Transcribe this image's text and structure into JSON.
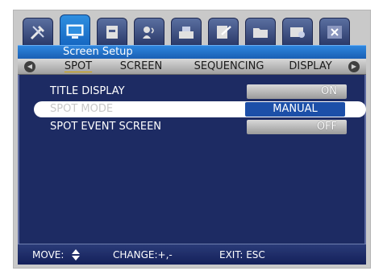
{
  "window": {
    "title": "Screen Setup"
  },
  "top_tabs": [
    {
      "icon": "tools-icon"
    },
    {
      "icon": "monitor-icon",
      "active": true
    },
    {
      "icon": "recorder-icon"
    },
    {
      "icon": "camera-icon"
    },
    {
      "icon": "network-icon"
    },
    {
      "icon": "checklist-icon"
    },
    {
      "icon": "folder-icon"
    },
    {
      "icon": "device-icon"
    },
    {
      "icon": "close-icon"
    }
  ],
  "sub_tabs": {
    "items": [
      "SPOT",
      "SCREEN",
      "SEQUENCING",
      "DISPLAY"
    ],
    "active": "SPOT"
  },
  "settings": [
    {
      "label": "TITLE DISPLAY",
      "value": "ON"
    },
    {
      "label": "SPOT MODE",
      "value": "MANUAL",
      "selected": true
    },
    {
      "label": "SPOT EVENT SCREEN",
      "value": "OFF"
    }
  ],
  "footer": {
    "move": "MOVE:",
    "change": "CHANGE:+,-",
    "exit": "EXIT: ESC"
  },
  "colors": {
    "panel": "#1d2b63",
    "titlebar": "#2e86de",
    "selected_value": "#1c4fa8"
  }
}
